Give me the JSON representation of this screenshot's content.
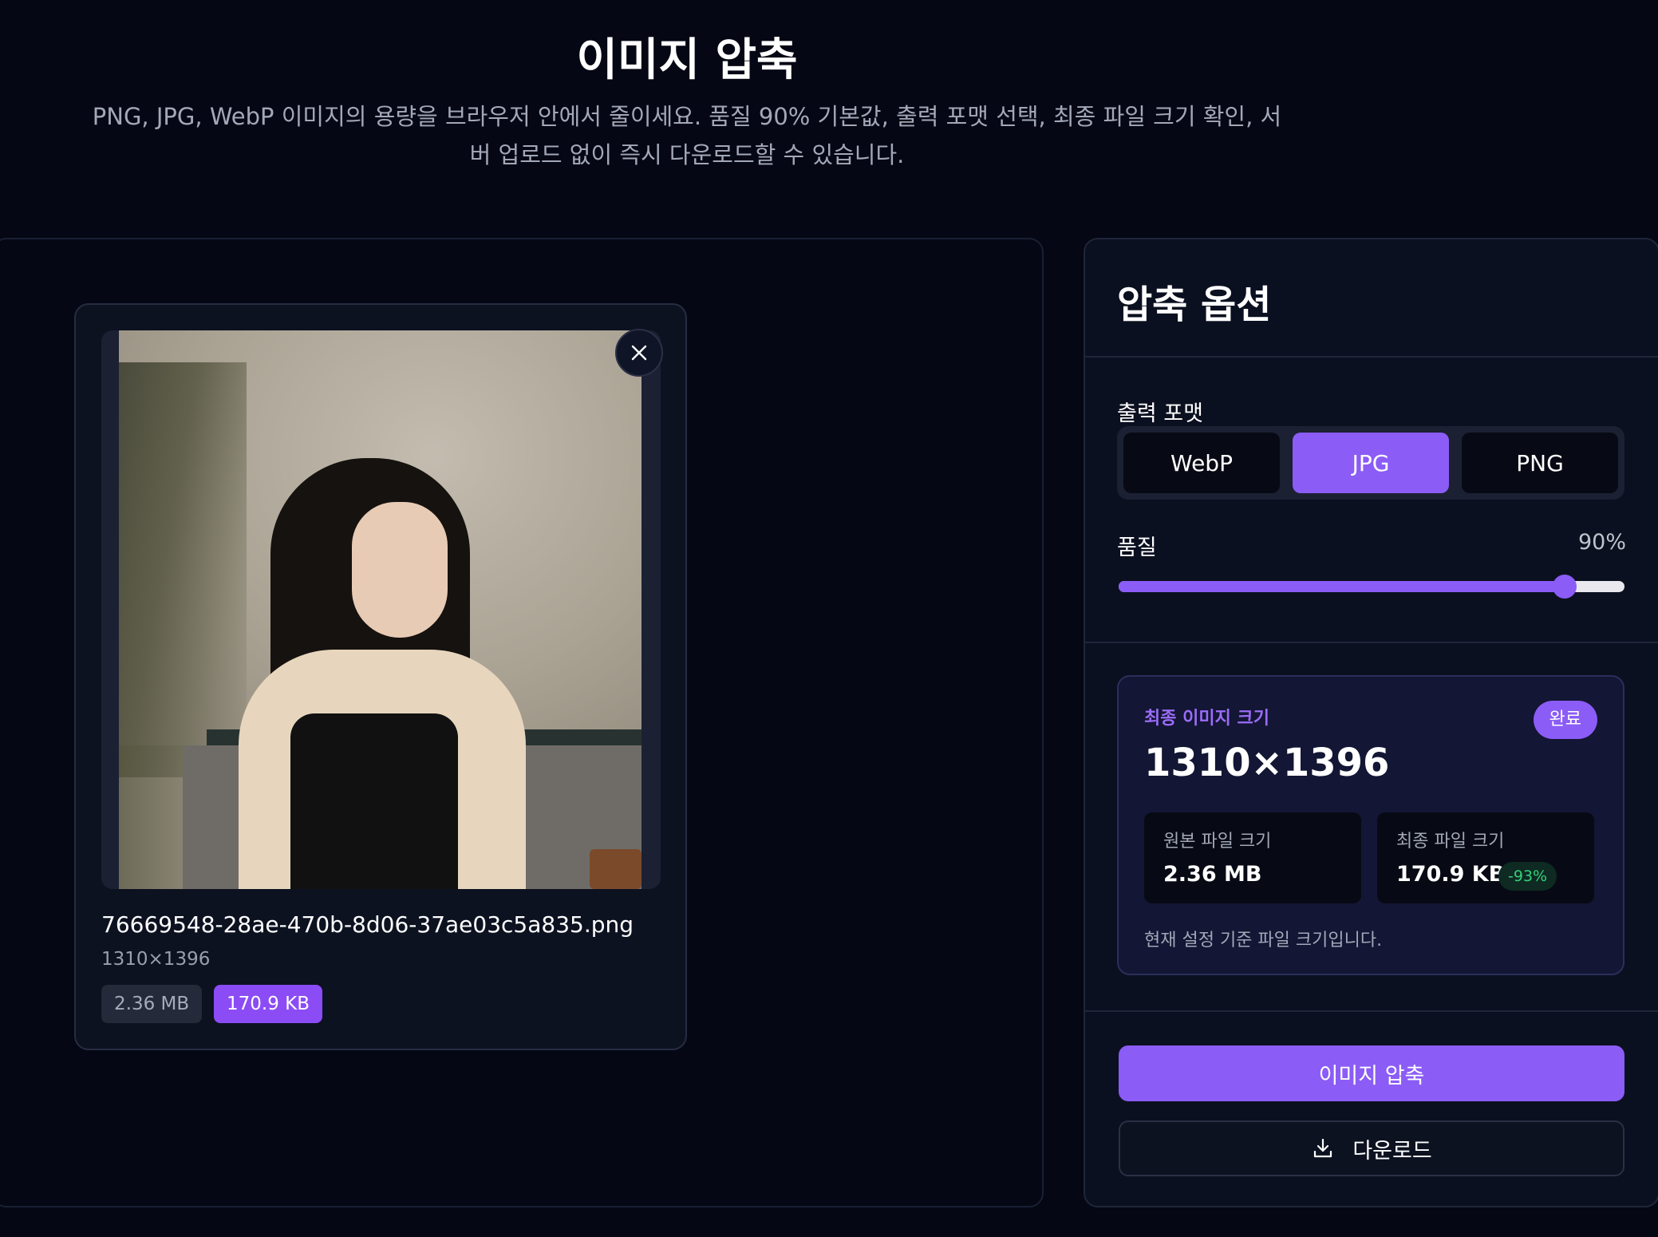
{
  "header": {
    "title": "이미지 압축",
    "description_line1": "PNG, JPG, WebP 이미지의 용량을 브라우저 안에서 줄이세요. 품질 90% 기본값, 출력 포맷 선택, 최종 파일 크기 확인, 서",
    "description_line2": "버 업로드 없이 즉시 다운로드할 수 있습니다."
  },
  "file": {
    "name": "76669548-28ae-470b-8d06-37ae03c5a835.png",
    "dimensions": "1310×1396",
    "original_size": "2.36 MB",
    "compressed_size": "170.9 KB",
    "close_icon": "close-icon"
  },
  "options": {
    "title": "압축 옵션",
    "format_label": "출력 포맷",
    "formats": [
      "WebP",
      "JPG",
      "PNG"
    ],
    "selected_format": "JPG",
    "quality_label": "품질",
    "quality_value": "90%",
    "quality": 0.9
  },
  "result": {
    "label": "최종 이미지 크기",
    "status": "완료",
    "dimensions": "1310×1396",
    "original_label": "원본 파일 크기",
    "original_value": "2.36 MB",
    "final_label": "최종 파일 크기",
    "final_value": "170.9 KB",
    "savings": "-93%",
    "note": "현재 설정 기준 파일 크기입니다."
  },
  "actions": {
    "compress_label": "이미지 압축",
    "download_label": "다운로드",
    "download_icon": "download-icon"
  },
  "colors": {
    "accent": "#8b5cf6",
    "background": "#050714",
    "success": "#33d17a"
  }
}
